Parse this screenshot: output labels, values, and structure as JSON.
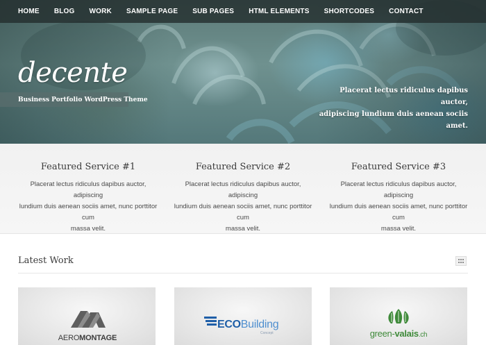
{
  "nav": {
    "items": [
      "HOME",
      "BLOG",
      "WORK",
      "SAMPLE PAGE",
      "SUB PAGES",
      "HTML ELEMENTS",
      "SHORTCODES",
      "CONTACT"
    ]
  },
  "hero": {
    "logo": "decente",
    "tagline": "Business Portfolio WordPress Theme",
    "description_line1": "Placerat lectus ridiculus dapibus auctor,",
    "description_line2": "adipiscing lundium duis aenean sociis amet."
  },
  "features": [
    {
      "title": "Featured Service #1",
      "line1": "Placerat lectus ridiculus dapibus auctor, adipiscing",
      "line2": "lundium duis aenean sociis amet, nunc porttitor cum",
      "line3": "massa velit."
    },
    {
      "title": "Featured Service #2",
      "line1": "Placerat lectus ridiculus dapibus auctor, adipiscing",
      "line2": "lundium duis aenean sociis amet, nunc porttitor cum",
      "line3": "massa velit."
    },
    {
      "title": "Featured Service #3",
      "line1": "Placerat lectus ridiculus dapibus auctor, adipiscing",
      "line2": "lundium duis aenean sociis amet, nunc porttitor cum",
      "line3": "massa velit."
    }
  ],
  "latest_work": {
    "title": "Latest Work",
    "grid_icon": "grid-icon",
    "cards": [
      {
        "logo_text_light": "AERO",
        "logo_text_bold": "MONTAGE"
      },
      {
        "logo_text_eco": "ECO",
        "logo_text_building": "Building",
        "logo_sub": "Concept"
      },
      {
        "logo_text_green": "green-",
        "logo_text_valais": "valais",
        "logo_text_ch": ".ch"
      }
    ]
  },
  "colors": {
    "nav_bg": "#232d2d",
    "hero_tint": "#6f918f",
    "features_bg": "#f1f1f1",
    "eco_blue": "#1f5fa8",
    "valais_green": "#3f8a3a"
  }
}
